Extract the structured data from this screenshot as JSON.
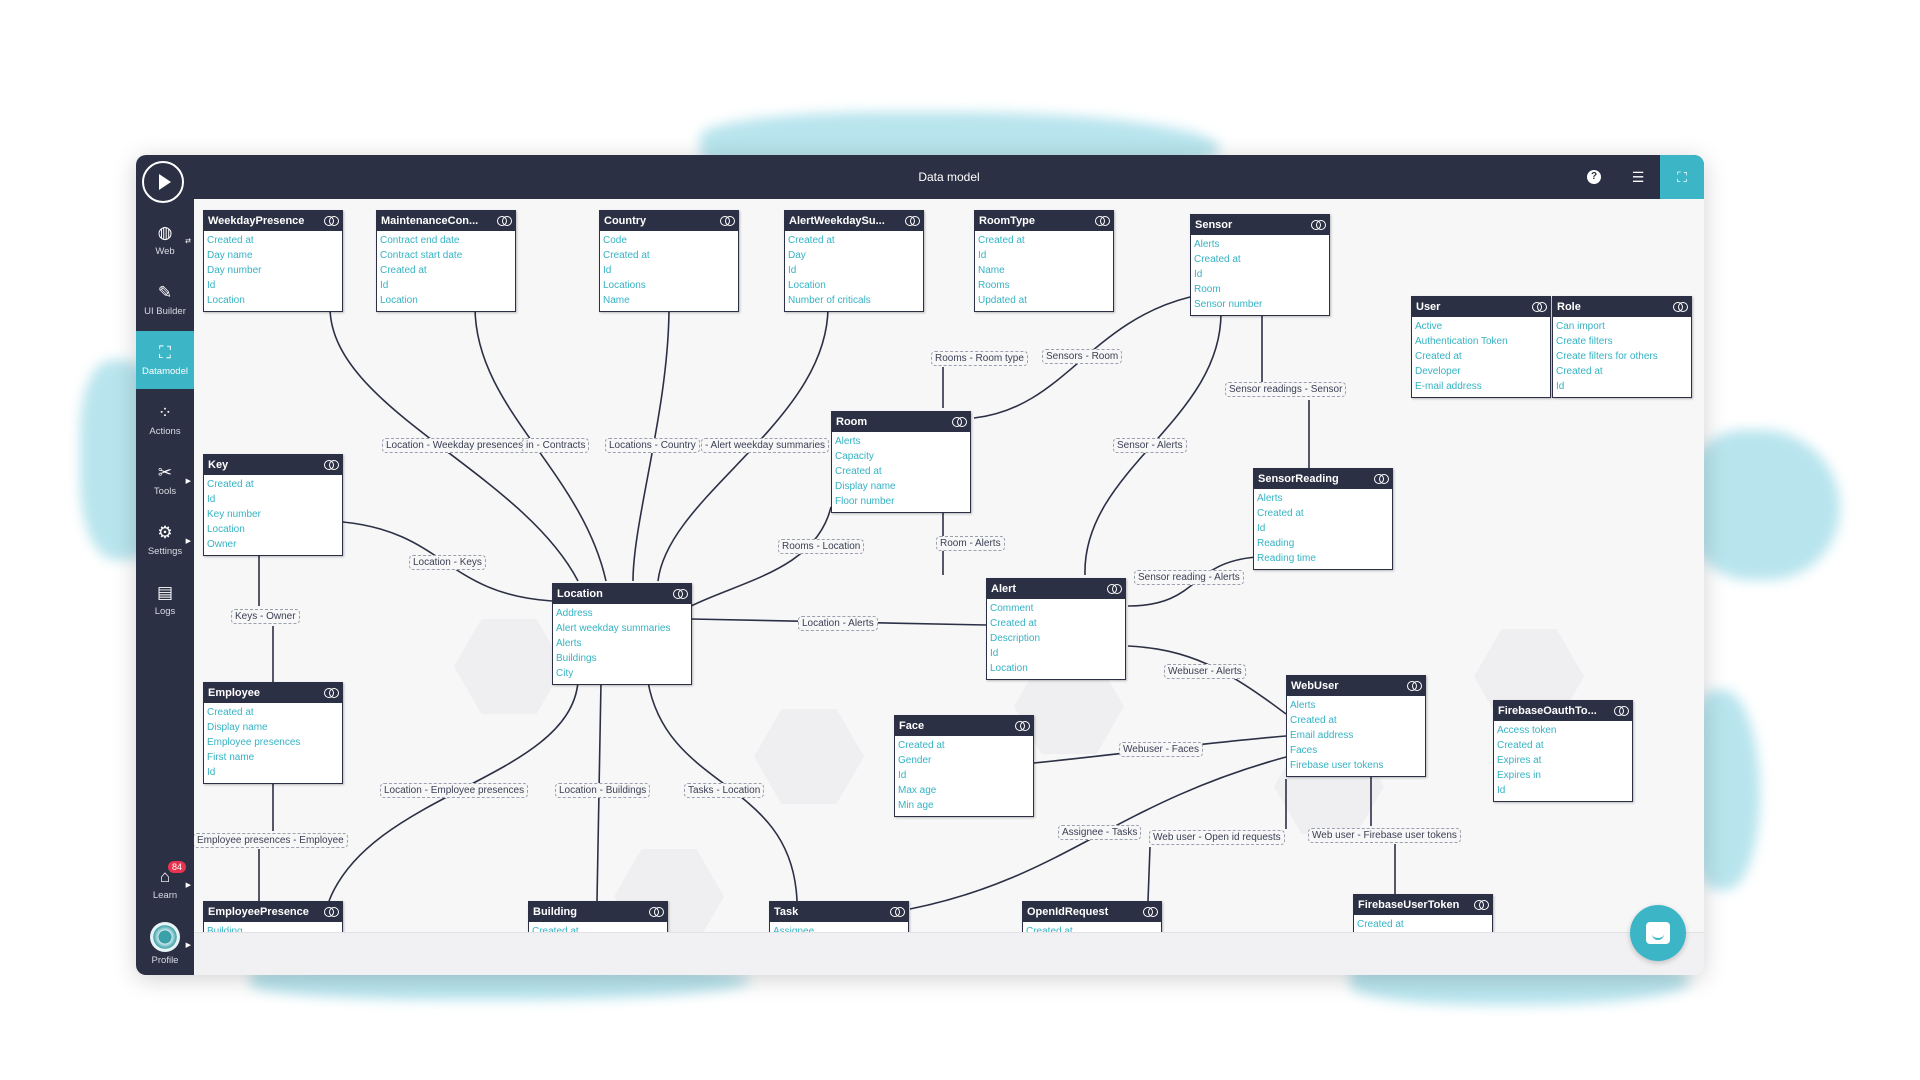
{
  "header": {
    "title": "Data model",
    "buttons": [
      {
        "name": "help",
        "icon": "question-circle-icon",
        "glyph": "?"
      },
      {
        "name": "list-view",
        "icon": "list-icon",
        "glyph": "☰"
      },
      {
        "name": "diagram-view",
        "icon": "sitemap-icon",
        "glyph": "⛶",
        "active": true
      }
    ]
  },
  "sidebar": {
    "play": {
      "icon": "play-icon"
    },
    "items": [
      {
        "label": "Web",
        "icon": "globe-icon",
        "glyph": "◍"
      },
      {
        "label": "UI Builder",
        "icon": "pencil-ruler-icon",
        "glyph": "✎"
      },
      {
        "label": "Datamodel",
        "icon": "sitemap-icon",
        "glyph": "⛶",
        "active": true
      },
      {
        "label": "Actions",
        "icon": "flow-icon",
        "glyph": "⁘"
      },
      {
        "label": "Tools",
        "icon": "tools-icon",
        "glyph": "✂"
      },
      {
        "label": "Settings",
        "icon": "gear-icon",
        "glyph": "⚙"
      },
      {
        "label": "Logs",
        "icon": "log-file-icon",
        "glyph": "▤"
      }
    ],
    "learn": {
      "label": "Learn",
      "icon": "graduation-cap-icon",
      "glyph": "🎓",
      "badge": "84"
    },
    "profile": {
      "label": "Profile",
      "icon": "avatar-icon"
    }
  },
  "entities": [
    {
      "name": "WeekdayPresence",
      "fields": [
        "Created at",
        "Day name",
        "Day number",
        "Id",
        "Location"
      ]
    },
    {
      "name": "MaintenanceCon...",
      "fields": [
        "Contract end date",
        "Contract start date",
        "Created at",
        "Id",
        "Location"
      ]
    },
    {
      "name": "Country",
      "fields": [
        "Code",
        "Created at",
        "Id",
        "Locations",
        "Name"
      ]
    },
    {
      "name": "AlertWeekdaySu...",
      "fields": [
        "Created at",
        "Day",
        "Id",
        "Location",
        "Number of criticals"
      ]
    },
    {
      "name": "RoomType",
      "fields": [
        "Created at",
        "Id",
        "Name",
        "Rooms",
        "Updated at"
      ]
    },
    {
      "name": "Sensor",
      "fields": [
        "Alerts",
        "Created at",
        "Id",
        "Room",
        "Sensor number"
      ]
    },
    {
      "name": "User",
      "fields": [
        "Active",
        "Authentication Token",
        "Created at",
        "Developer",
        "E-mail address"
      ]
    },
    {
      "name": "Role",
      "fields": [
        "Can import",
        "Create filters",
        "Create filters for others",
        "Created at",
        "Id"
      ]
    },
    {
      "name": "Room",
      "fields": [
        "Alerts",
        "Capacity",
        "Created at",
        "Display name",
        "Floor number"
      ]
    },
    {
      "name": "Key",
      "fields": [
        "Created at",
        "Id",
        "Key number",
        "Location",
        "Owner"
      ]
    },
    {
      "name": "SensorReading",
      "fields": [
        "Alerts",
        "Created at",
        "Id",
        "Reading",
        "Reading time"
      ]
    },
    {
      "name": "Location",
      "fields": [
        "Address",
        "Alert weekday summaries",
        "Alerts",
        "Buildings",
        "City"
      ]
    },
    {
      "name": "Alert",
      "fields": [
        "Comment",
        "Created at",
        "Description",
        "Id",
        "Location"
      ]
    },
    {
      "name": "Employee",
      "fields": [
        "Created at",
        "Display name",
        "Employee presences",
        "First name",
        "Id"
      ]
    },
    {
      "name": "WebUser",
      "fields": [
        "Alerts",
        "Created at",
        "Email address",
        "Faces",
        "Firebase user tokens"
      ]
    },
    {
      "name": "Face",
      "fields": [
        "Created at",
        "Gender",
        "Id",
        "Max age",
        "Min age"
      ]
    },
    {
      "name": "FirebaseOauthTo...",
      "fields": [
        "Access token",
        "Created at",
        "Expires at",
        "Expires in",
        "Id"
      ]
    },
    {
      "name": "EmployeePresence",
      "fields": [
        "Building"
      ]
    },
    {
      "name": "Building",
      "fields": [
        "Created at"
      ]
    },
    {
      "name": "Task",
      "fields": [
        "Assignee"
      ]
    },
    {
      "name": "OpenIdRequest",
      "fields": [
        "Created at"
      ]
    },
    {
      "name": "FirebaseUserToken",
      "fields": [
        "Created at"
      ]
    }
  ],
  "relations": [
    "Location - Weekday presences",
    "in - Contracts",
    "Locations - Country",
    "- Alert weekday summaries",
    "Rooms - Room type",
    "Sensors - Room",
    "Sensor readings - Sensor",
    "Sensor - Alerts",
    "Rooms - Location",
    "Room - Alerts",
    "Location - Keys",
    "Keys - Owner",
    "Sensor reading - Alerts",
    "Location - Alerts",
    "Webuser - Alerts",
    "Webuser - Faces",
    "Location - Employee presences",
    "Location - Buildings",
    "Tasks - Location",
    "Employee presences - Employee",
    "Assignee - Tasks",
    "Web user - Open id requests",
    "Web user - Firebase user tokens"
  ],
  "chat": {
    "icon": "chat-bubble-icon"
  },
  "colors": {
    "accent": "#3cb6c6",
    "dark": "#2c3044",
    "field": "#35b3c4",
    "badge": "#e8344e"
  }
}
